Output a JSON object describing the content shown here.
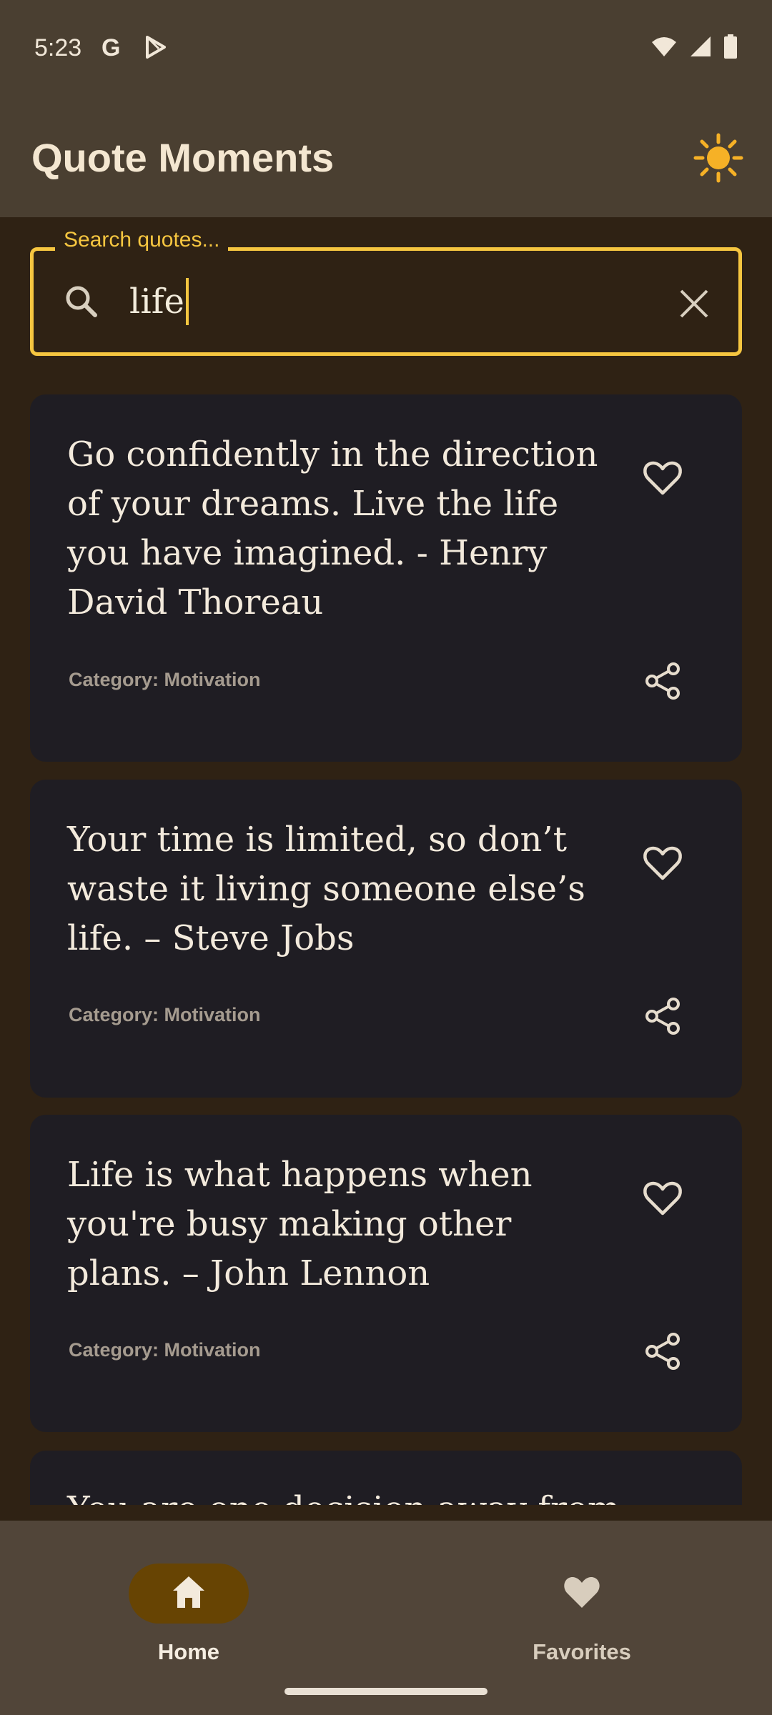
{
  "status_bar": {
    "time": "5:23",
    "icons_left": [
      "google-icon",
      "play-store-icon"
    ],
    "icons_right": [
      "wifi-icon",
      "cellular-signal-icon",
      "battery-icon"
    ]
  },
  "app_bar": {
    "title": "Quote Moments",
    "theme_icon": "sun-icon"
  },
  "search": {
    "label": "Search quotes...",
    "value": "life",
    "search_icon": "search-icon",
    "clear_icon": "close-icon"
  },
  "quotes": [
    {
      "text": "Go confidently in the direction of your dreams. Live the life you have imagined. - Henry David Thoreau",
      "category_label": "Category: Motivation",
      "favorite": false
    },
    {
      "text": "Your time is limited, so don’t waste it living someone else’s life. – Steve Jobs",
      "category_label": "Category: Motivation",
      "favorite": false
    },
    {
      "text": "Life is what happens when you're busy making other plans. – John Lennon",
      "category_label": "Category: Motivation",
      "favorite": false
    },
    {
      "text": "You are one decision away from",
      "category_label": "",
      "favorite": false
    }
  ],
  "bottom_nav": {
    "items": [
      {
        "label": "Home",
        "icon": "home-icon",
        "active": true
      },
      {
        "label": "Favorites",
        "icon": "heart-icon",
        "active": false
      }
    ]
  },
  "colors": {
    "app_bar_bg": "#4a3f31",
    "page_bg": "#2f2214",
    "card_bg": "#1f1d23",
    "accent": "#f6c640",
    "active_nav_pill": "#674403"
  }
}
